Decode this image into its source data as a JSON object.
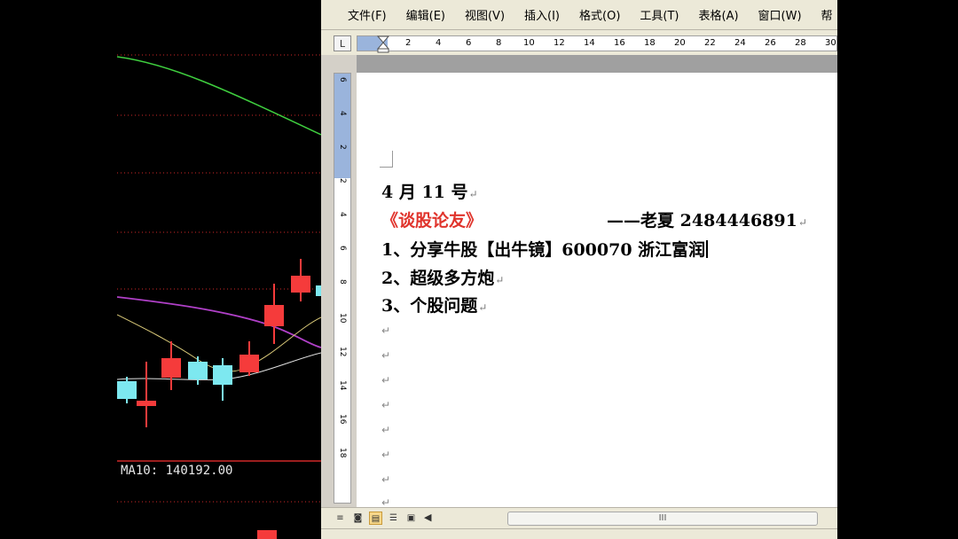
{
  "chart": {
    "ma10_label": "MA10: 140192.00",
    "colors": {
      "up": "#f53b3b",
      "down": "#7de8f0",
      "ma_green": "#3fcf3f",
      "ma_purple": "#b040c8",
      "ma_yellow": "#d8c878",
      "grid_red": "#d02828"
    }
  },
  "word": {
    "menu": [
      "文件(F)",
      "编辑(E)",
      "视图(V)",
      "插入(I)",
      "格式(O)",
      "工具(T)",
      "表格(A)",
      "窗口(W)",
      "帮"
    ],
    "ruler_corner": "L",
    "ruler_ticks": [
      "2",
      "4",
      "6",
      "8",
      "10",
      "12",
      "14",
      "16",
      "18",
      "20",
      "22",
      "24",
      "26",
      "28",
      "30"
    ],
    "vruler_ticks": [
      "6",
      "4",
      "2",
      "2",
      "4",
      "6",
      "8",
      "10",
      "12",
      "14",
      "16",
      "18"
    ],
    "document": {
      "line1": "4 月 11 号",
      "line2_title": "《谈股论友》",
      "line2_author": "——老夏 2484446891",
      "line3": "1、分享牛股【出牛镜】600070 浙江富润",
      "line4": "2、超级多方炮",
      "line5": "3、个股问题",
      "paragraph_mark": "↵"
    },
    "scrollbar_grip": "III"
  }
}
